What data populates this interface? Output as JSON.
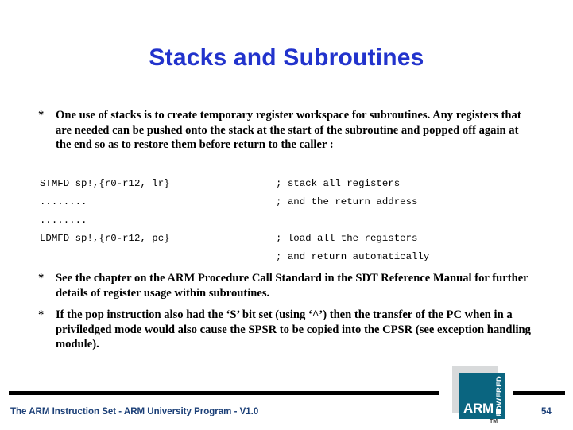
{
  "slide": {
    "title": "Stacks and Subroutines",
    "title_color": "#2233cc",
    "background_color": "#ffffff"
  },
  "bullets": [
    {
      "marker": "*",
      "text": "One use of stacks is to create temporary register workspace for subroutines. Any registers that are needed can be pushed onto the stack at the start of the subroutine and popped off again at the end so as to restore them before return to the caller :"
    },
    {
      "marker": "*",
      "text": "See the chapter on the ARM Procedure Call Standard in the SDT Reference Manual for further details of register usage within subroutines."
    },
    {
      "marker": "*",
      "text": "If the pop instruction also had the ‘S’ bit set (using ‘^’) then the transfer of the PC when in a priviledged mode would also cause the SPSR to be copied into the CPSR (see exception handling module)."
    }
  ],
  "code_block": {
    "lines": [
      {
        "instruction": "STMFD sp!,{r0-r12, lr}",
        "comment": "; stack all registers"
      },
      {
        "instruction": "........",
        "comment": "; and the return address"
      },
      {
        "instruction": "........",
        "comment": ""
      },
      {
        "instruction": "LDMFD sp!,{r0-r12, pc}",
        "comment": "; load all the registers"
      },
      {
        "instruction": "",
        "comment": "; and return automatically"
      }
    ]
  },
  "footer": {
    "text": "The ARM Instruction Set - ARM University Program - V1.0",
    "page_number": "54",
    "text_color": "#1b3f77",
    "rule_color": "#000000"
  },
  "logo": {
    "wordmark": "ARM",
    "tagline": "POWERED",
    "trademark": "TM",
    "square_color": "#0a6580",
    "shadow_color": "#d8dadb"
  }
}
